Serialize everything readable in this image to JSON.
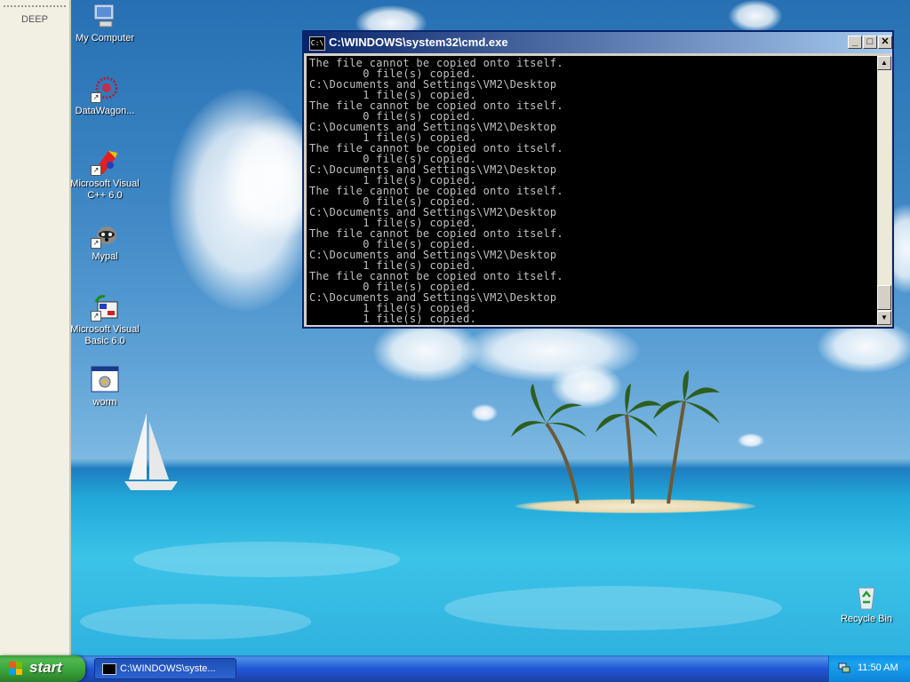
{
  "sidebar": {
    "title": "DEEP"
  },
  "desktop_icons": [
    {
      "label": "My Computer",
      "icon": "my-computer-icon"
    },
    {
      "label": "DataWagon...",
      "icon": "datawagon-icon"
    },
    {
      "label": "Microsoft Visual C++ 6.0",
      "icon": "visual-cpp-icon"
    },
    {
      "label": "Mypal",
      "icon": "mypal-icon"
    },
    {
      "label": "Microsoft Visual Basic 6.0",
      "icon": "visual-basic-icon"
    },
    {
      "label": "worm",
      "icon": "worm-app-icon"
    },
    {
      "label": "Recycle Bin",
      "icon": "recycle-bin-icon"
    }
  ],
  "cmd_window": {
    "title": "C:\\WINDOWS\\system32\\cmd.exe",
    "icon_text": "C:\\",
    "minimize": "_",
    "maximize": "□",
    "close": "✕",
    "scroll_up": "▲",
    "scroll_down": "▼",
    "console_lines": [
      "The file cannot be copied onto itself.",
      "        0 file(s) copied.",
      "C:\\Documents and Settings\\VM2\\Desktop",
      "        1 file(s) copied.",
      "The file cannot be copied onto itself.",
      "        0 file(s) copied.",
      "C:\\Documents and Settings\\VM2\\Desktop",
      "        1 file(s) copied.",
      "The file cannot be copied onto itself.",
      "        0 file(s) copied.",
      "C:\\Documents and Settings\\VM2\\Desktop",
      "        1 file(s) copied.",
      "The file cannot be copied onto itself.",
      "        0 file(s) copied.",
      "C:\\Documents and Settings\\VM2\\Desktop",
      "        1 file(s) copied.",
      "The file cannot be copied onto itself.",
      "        0 file(s) copied.",
      "C:\\Documents and Settings\\VM2\\Desktop",
      "        1 file(s) copied.",
      "The file cannot be copied onto itself.",
      "        0 file(s) copied.",
      "C:\\Documents and Settings\\VM2\\Desktop",
      "        1 file(s) copied.",
      "        1 file(s) copied."
    ]
  },
  "taskbar": {
    "start_label": "start",
    "task_item_label": "C:\\WINDOWS\\syste...",
    "clock": "11:50 AM"
  }
}
